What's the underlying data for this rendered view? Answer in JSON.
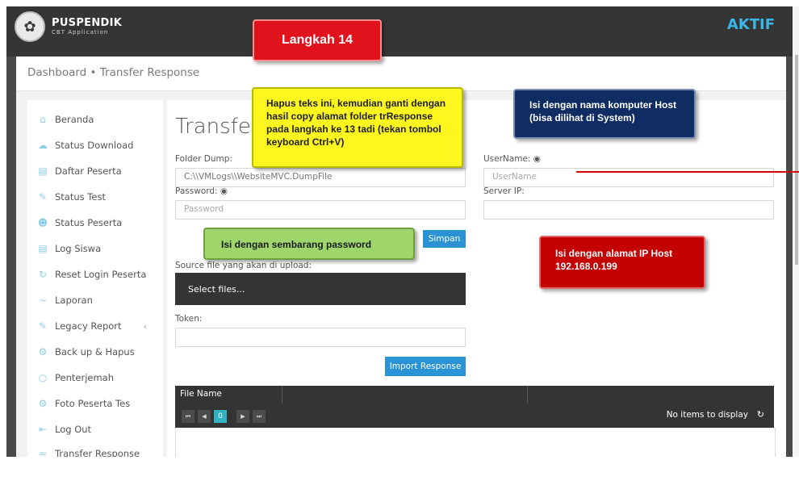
{
  "app": {
    "logo_title": "PUSPENDIK",
    "logo_subtitle": "CBT Application",
    "status": "AKTIF"
  },
  "breadcrumb": "Dashboard • Transfer Response",
  "sidebar": {
    "items": [
      {
        "label": "Beranda",
        "icon": "home-icon"
      },
      {
        "label": "Status Download",
        "icon": "cloud-download-icon"
      },
      {
        "label": "Daftar Peserta",
        "icon": "document-icon"
      },
      {
        "label": "Status Test",
        "icon": "edit-icon"
      },
      {
        "label": "Status Peserta",
        "icon": "user-icon"
      },
      {
        "label": "Log Siswa",
        "icon": "document-icon"
      },
      {
        "label": "Reset Login Peserta",
        "icon": "refresh-icon"
      },
      {
        "label": "Laporan",
        "icon": "chart-line-icon"
      },
      {
        "label": "Legacy Report",
        "icon": "edit-icon"
      },
      {
        "label": "Back up & Hapus",
        "icon": "gear-icon"
      },
      {
        "label": "Penterjemah",
        "icon": "chat-icon"
      },
      {
        "label": "Foto Peserta Tes",
        "icon": "gear-icon"
      },
      {
        "label": "Log Out",
        "icon": "logout-icon"
      },
      {
        "label": "Transfer Response",
        "icon": "rss-icon"
      }
    ],
    "legacy_chevron": "‹"
  },
  "form": {
    "title": "Transfe",
    "folder_dump_label": "Folder Dump:",
    "folder_dump_value": "C:\\\\VMLogs\\\\WebsiteMVC.DumpFile",
    "password_label": "Password: ◉",
    "password_placeholder": "Password",
    "username_label": "UserName: ◉",
    "username_placeholder": "UserName",
    "server_ip_label": "Server IP:",
    "server_ip_value": "",
    "save_button": "Simpan",
    "source_label": "Source file yang akan di upload:",
    "select_files": "Select files...",
    "token_label": "Token:",
    "token_value": "",
    "import_button": "Import Response"
  },
  "grid": {
    "column_file_name": "File Name",
    "pager": {
      "first": "⏮",
      "prev": "◀",
      "current": "0",
      "next": "▶",
      "last": "⏭"
    },
    "empty_text": "No items to display",
    "refresh_icon": "↻"
  },
  "callouts": {
    "step": "Langkah 14",
    "yellow": "Hapus teks ini, kemudian ganti dengan hasil copy alamat folder trResponse pada langkah ke 13 tadi (tekan tombol keyboard Ctrl+V)",
    "navy": "Isi dengan nama komputer Host (bisa dilihat di System)",
    "green": "Isi dengan sembarang password",
    "red": "Isi dengan alamat IP Host 192.168.0.199"
  },
  "colors": {
    "accent": "#2a93d5",
    "status": "#3bb6e8",
    "pager_current": "#2fb3c2"
  }
}
